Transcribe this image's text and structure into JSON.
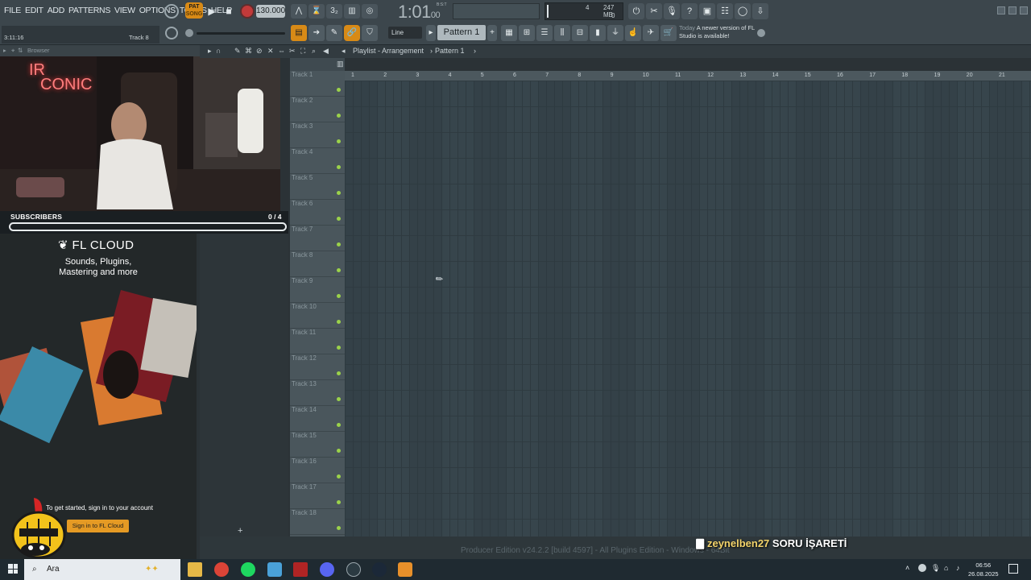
{
  "menu": [
    "FILE",
    "EDIT",
    "ADD",
    "PATTERNS",
    "VIEW",
    "OPTIONS",
    "TOOLS",
    "HELP"
  ],
  "transport": {
    "pat_label": "PAT",
    "song_label": "SONG",
    "tempo": "130.000",
    "time_main": "1:01",
    "time_sub": "00",
    "time_format": "B:S:T",
    "memory": "247 MB",
    "cpu_value": "4",
    "polyphony": "0"
  },
  "hint": {
    "position": "3:11:16",
    "track": "Track 8"
  },
  "toolbar2": {
    "snap": "Line",
    "pattern": "Pattern 1"
  },
  "news": {
    "when": "Today",
    "text": "A newer version of FL Studio is available!"
  },
  "browser": {
    "title": "Browser"
  },
  "stream": {
    "webcam_sign_1": "IR",
    "webcam_sign_2": "CONIC",
    "subs_label": "SUBSCRIBERS",
    "subs_count": "0 / 4",
    "subs_fraction": 0.0
  },
  "cloud": {
    "title": "FL CLOUD",
    "line1": "Sounds, Plugins,",
    "line2": "Mastering and more",
    "signin_text": "To get started, sign in to your account",
    "signin_button": "Sign in to FL Cloud"
  },
  "playlist": {
    "breadcrumb": "Playlist - Arrangement",
    "pattern": "Pattern 1",
    "tracks": [
      "Track 1",
      "Track 2",
      "Track 3",
      "Track 4",
      "Track 5",
      "Track 6",
      "Track 7",
      "Track 8",
      "Track 9",
      "Track 10",
      "Track 11",
      "Track 12",
      "Track 13",
      "Track 14",
      "Track 15",
      "Track 16",
      "Track 17",
      "Track 18"
    ],
    "bars": [
      "1",
      "2",
      "3",
      "4",
      "5",
      "6",
      "7",
      "8",
      "9",
      "10",
      "11",
      "12",
      "13",
      "14",
      "15",
      "16",
      "17",
      "18",
      "19",
      "20",
      "21"
    ]
  },
  "status_line": "Producer Edition v24.2.2 [build 4597] - All Plugins Edition - Windows - 64Bit",
  "chat": {
    "user": "zeynelben27",
    "message": "SORU İŞARETİ"
  },
  "taskbar": {
    "search": "Ara",
    "time": "06:56",
    "date": "26.08.2025"
  }
}
